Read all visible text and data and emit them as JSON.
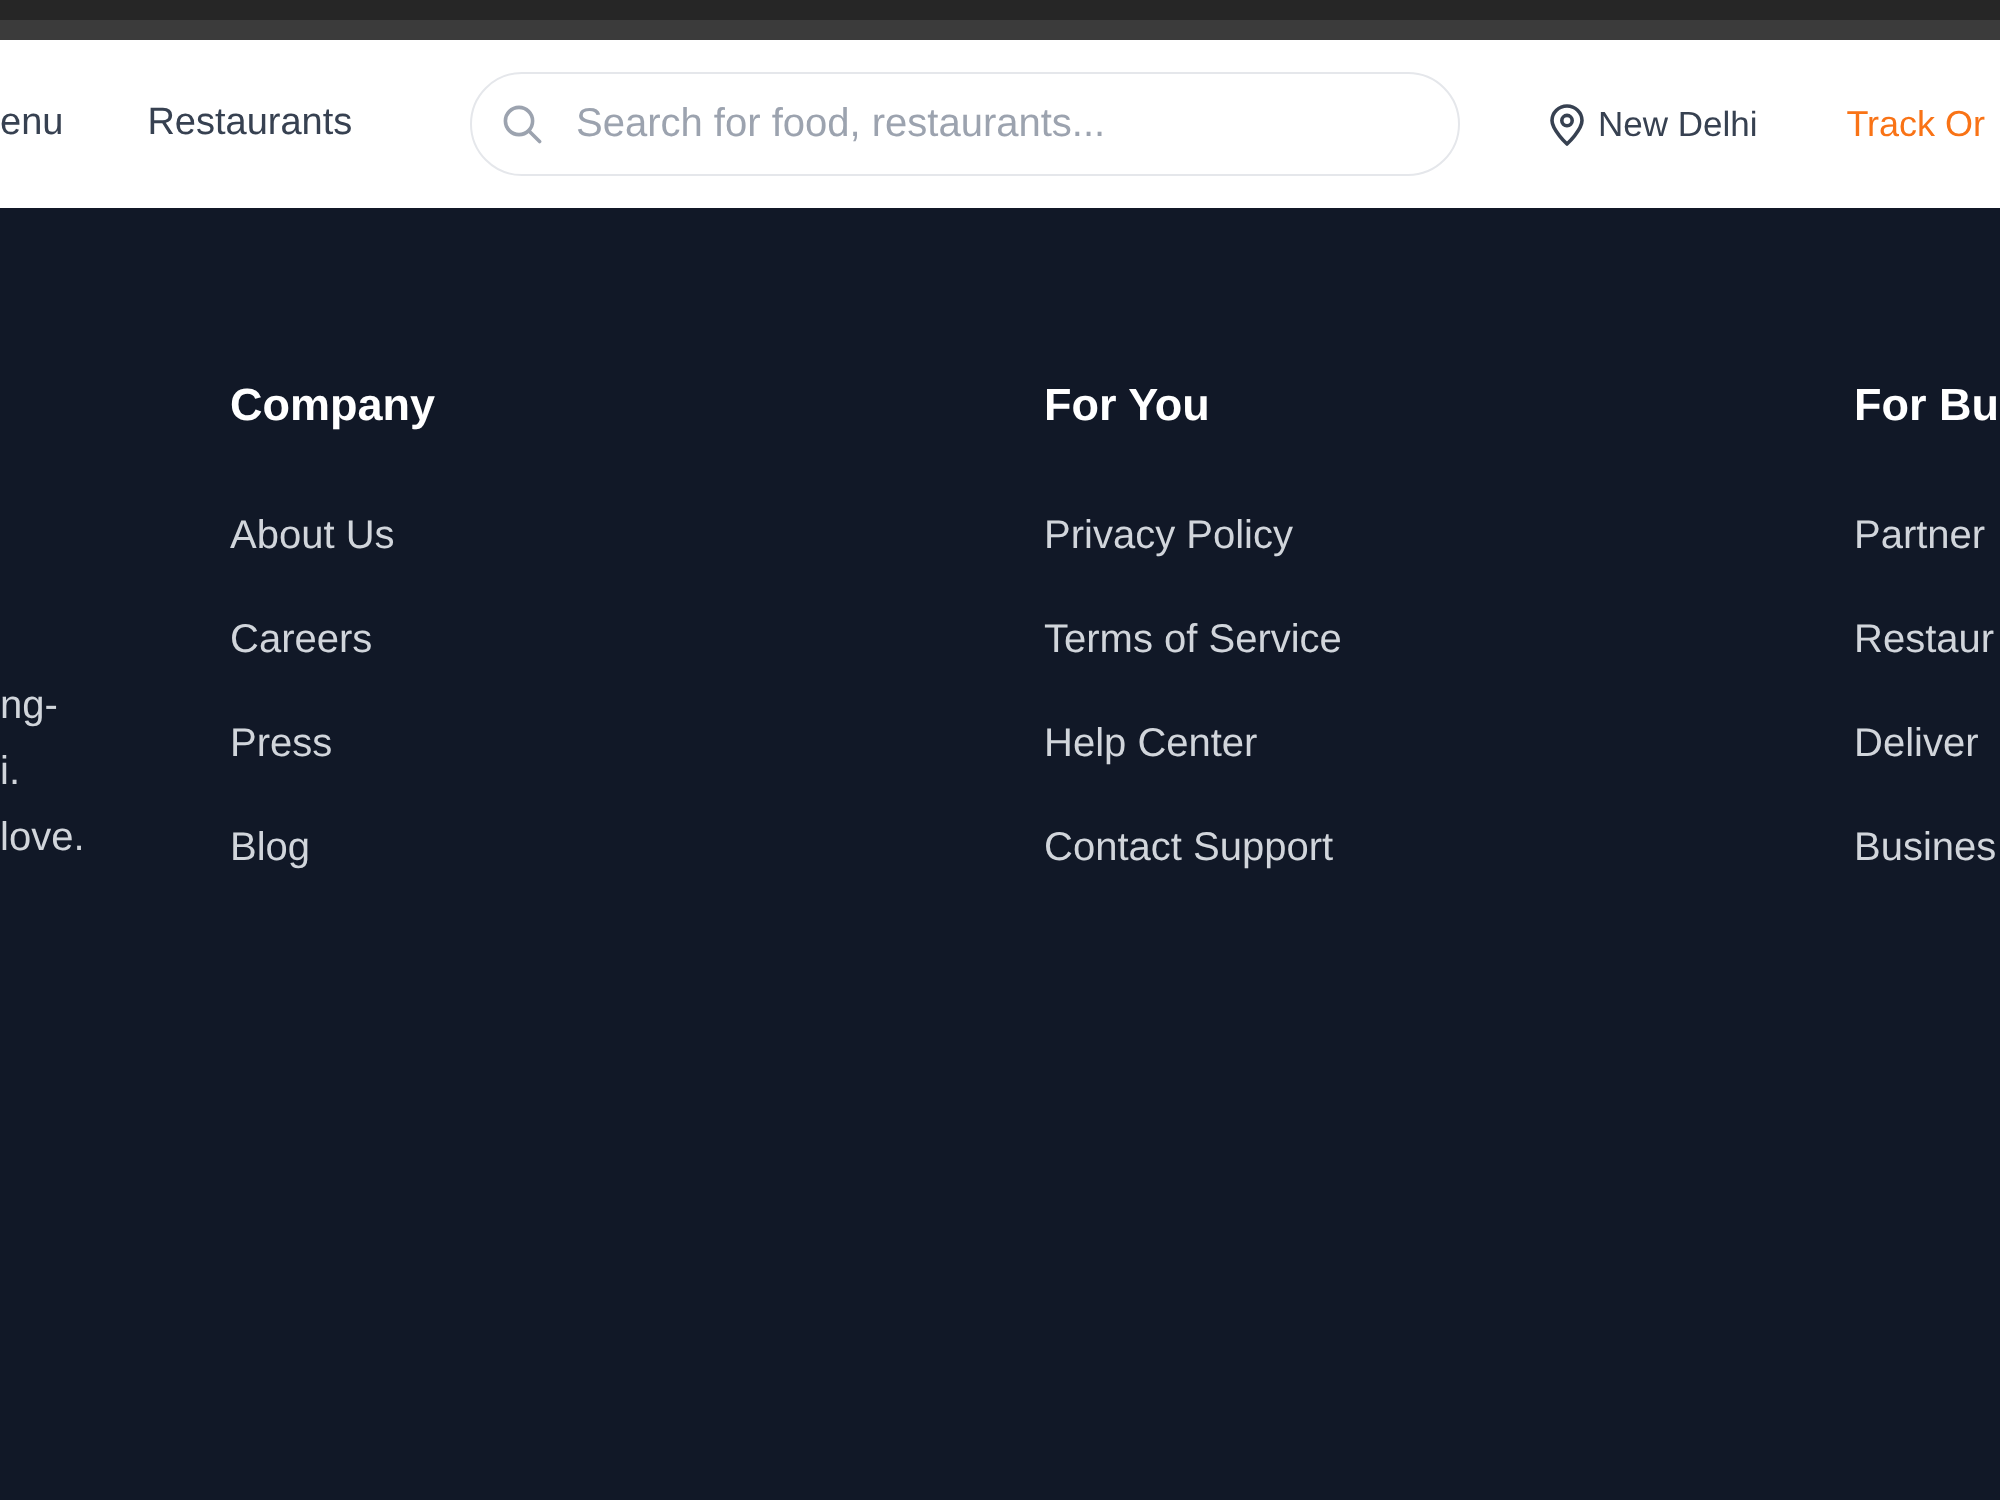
{
  "header": {
    "nav_links": [
      {
        "label": "enu"
      },
      {
        "label": "Restaurants"
      }
    ],
    "search": {
      "placeholder": "Search for food, restaurants..."
    },
    "location": "New Delhi",
    "track_order": "Track Or"
  },
  "footer": {
    "brand_description_lines": [
      "ng-",
      "i.",
      "love."
    ],
    "columns": [
      {
        "heading": "Company",
        "links": [
          "About Us",
          "Careers",
          "Press",
          "Blog"
        ]
      },
      {
        "heading": "For You",
        "links": [
          "Privacy Policy",
          "Terms of Service",
          "Help Center",
          "Contact Support"
        ]
      },
      {
        "heading": "For Bu",
        "links": [
          "Partner",
          "Restaur",
          "Deliver",
          "Busines"
        ]
      }
    ]
  }
}
